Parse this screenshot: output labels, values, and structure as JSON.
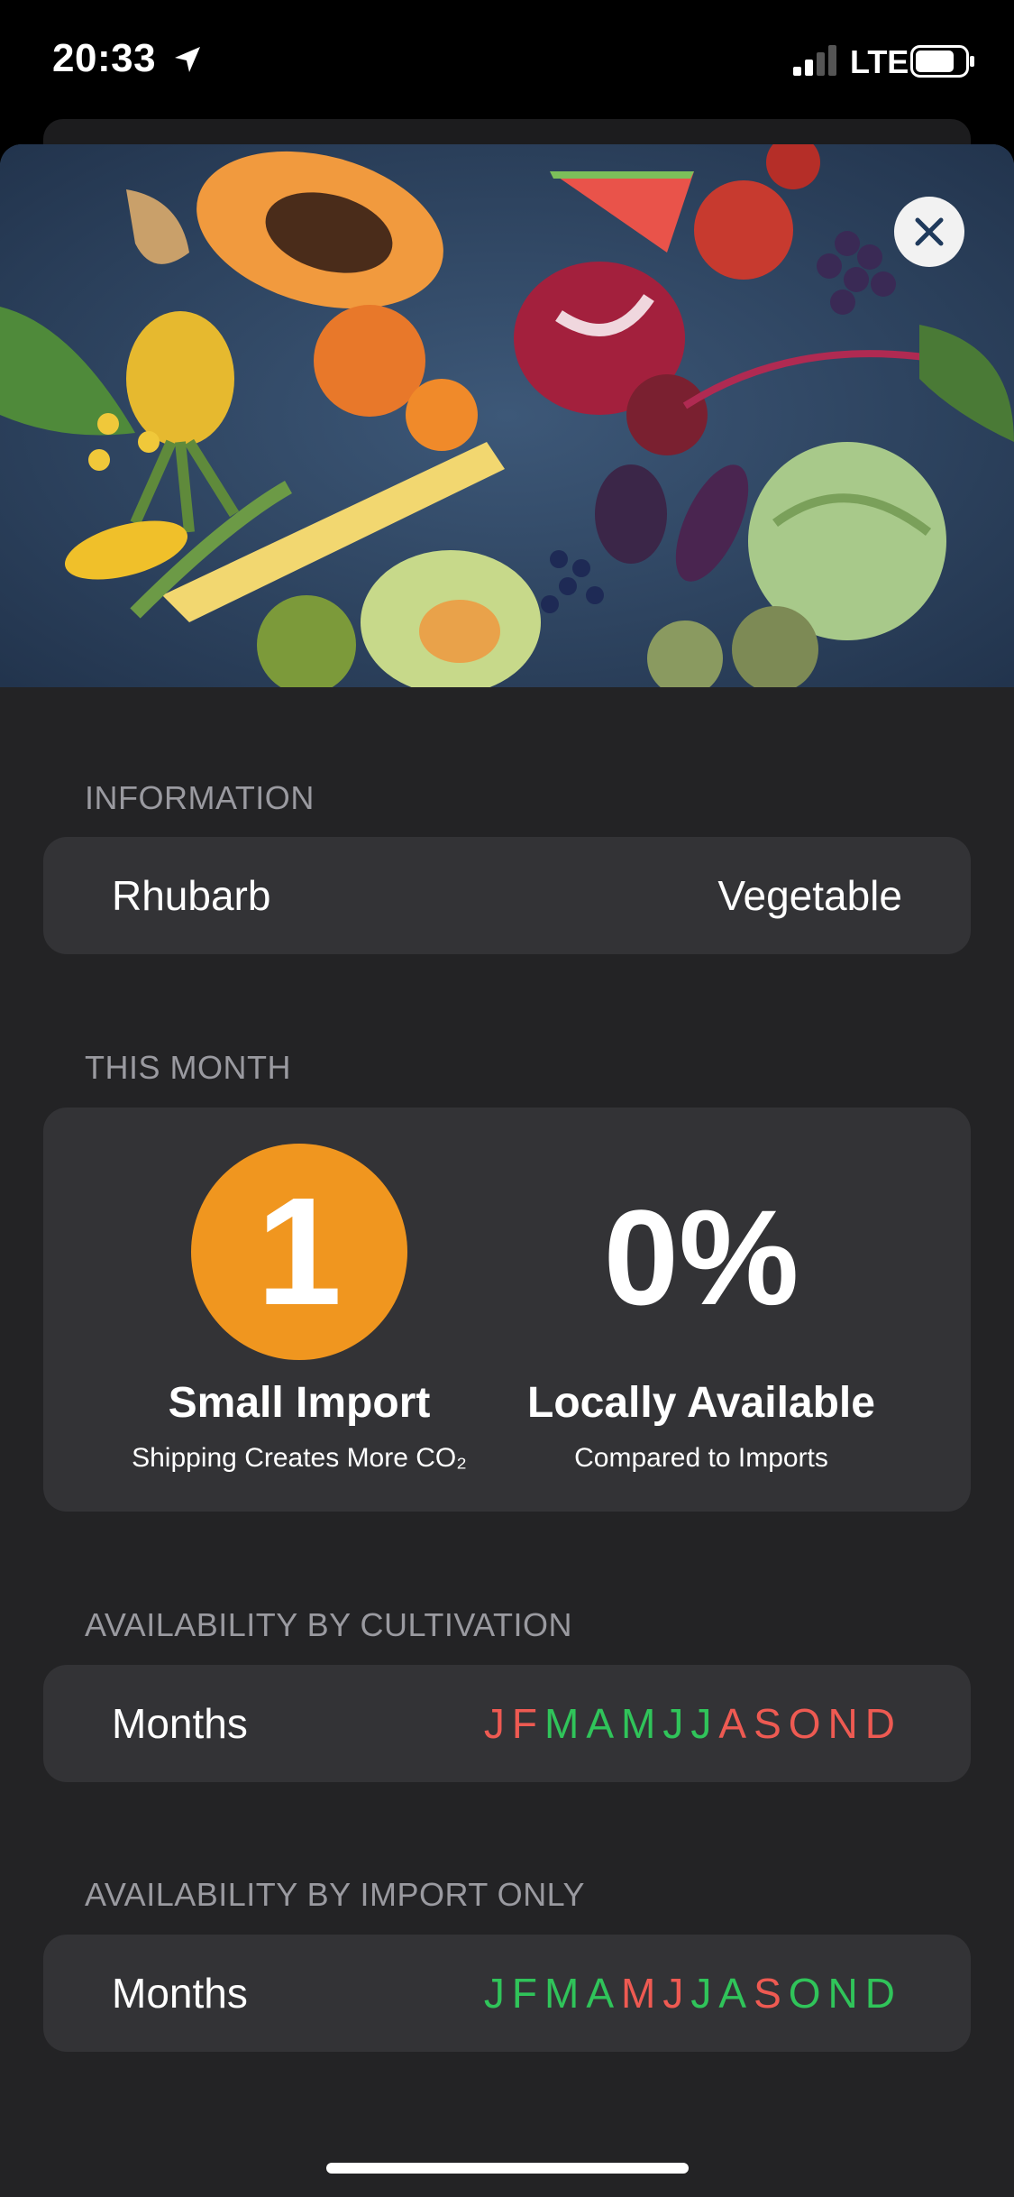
{
  "status_bar": {
    "time": "20:33",
    "network": "LTE",
    "icons": [
      "location-arrow-icon",
      "signal-icon",
      "battery-icon"
    ]
  },
  "hero_image": {
    "description_icon": "produce-photo",
    "close_icon": "close-icon"
  },
  "information": {
    "header": "INFORMATION",
    "name": "Rhubarb",
    "category": "Vegetable"
  },
  "this_month": {
    "header": "THIS MONTH",
    "import_rating": "1",
    "import_title": "Small Import",
    "import_subtitle": "Shipping Creates More CO₂",
    "local_percent": "0%",
    "local_title": "Locally Available",
    "local_subtitle": "Compared to Imports"
  },
  "cultivation": {
    "header": "AVAILABILITY BY CULTIVATION",
    "label": "Months",
    "months": [
      {
        "letter": "J",
        "available": false
      },
      {
        "letter": "F",
        "available": false
      },
      {
        "letter": "M",
        "available": true
      },
      {
        "letter": "A",
        "available": true
      },
      {
        "letter": "M",
        "available": true
      },
      {
        "letter": "J",
        "available": true
      },
      {
        "letter": "J",
        "available": true
      },
      {
        "letter": "A",
        "available": false
      },
      {
        "letter": "S",
        "available": false
      },
      {
        "letter": "O",
        "available": false
      },
      {
        "letter": "N",
        "available": false
      },
      {
        "letter": "D",
        "available": false
      }
    ]
  },
  "import_only": {
    "header": "AVAILABILITY BY IMPORT ONLY",
    "label": "Months",
    "months": [
      {
        "letter": "J",
        "available": true
      },
      {
        "letter": "F",
        "available": true
      },
      {
        "letter": "M",
        "available": true
      },
      {
        "letter": "A",
        "available": true
      },
      {
        "letter": "M",
        "available": false
      },
      {
        "letter": "J",
        "available": false
      },
      {
        "letter": "J",
        "available": true
      },
      {
        "letter": "A",
        "available": true
      },
      {
        "letter": "S",
        "available": false
      },
      {
        "letter": "O",
        "available": true
      },
      {
        "letter": "N",
        "available": true
      },
      {
        "letter": "D",
        "available": true
      }
    ]
  },
  "colors": {
    "available": "#30c45a",
    "unavailable": "#ee5a52",
    "accent": "#f0961f",
    "card": "#333336",
    "background": "#232325"
  }
}
